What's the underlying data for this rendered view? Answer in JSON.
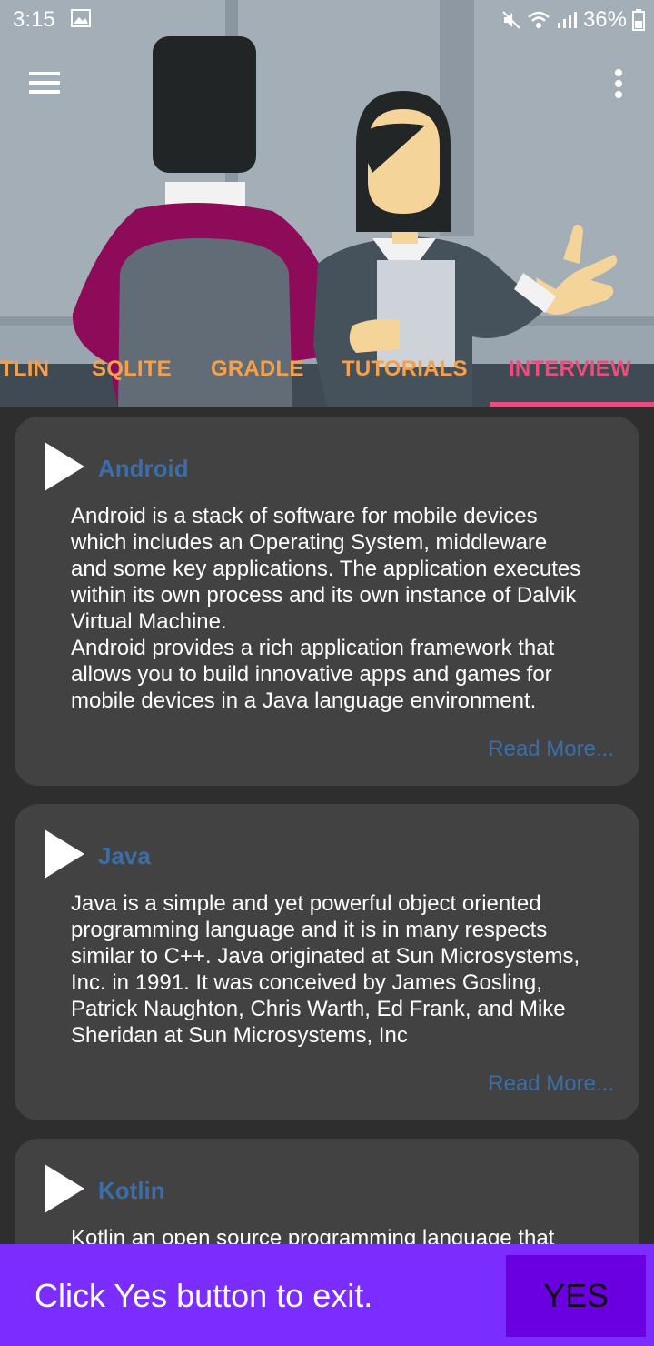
{
  "status": {
    "time": "3:15",
    "battery": "36%"
  },
  "icons": {
    "menu": "hamburger-menu-icon",
    "more": "more-vert-icon",
    "play": "play-triangle-icon"
  },
  "tabs": [
    {
      "label": "TLIN",
      "active": false
    },
    {
      "label": "SQLITE",
      "active": false
    },
    {
      "label": "GRADLE",
      "active": false
    },
    {
      "label": "TUTORIALS",
      "active": false
    },
    {
      "label": "INTERVIEW",
      "active": true
    }
  ],
  "cards": [
    {
      "title": "Android",
      "body": "Android is a stack of software for mobile devices\nwhich includes an Operating System, middleware\nand some key applications. The application executes\nwithin its own process and its own instance of Dalvik\nVirtual Machine.\nAndroid provides a rich application framework that\nallows you to build innovative apps and games for\nmobile devices in a Java language environment.",
      "more": "Read More..."
    },
    {
      "title": "Java",
      "body": "Java is a simple and yet powerful object oriented\nprogramming language and it is in many respects\nsimilar to C++. Java originated at Sun Microsystems,\nInc. in 1991. It was conceived by James Gosling,\nPatrick Naughton, Chris Warth, Ed Frank, and Mike\nSheridan at Sun Microsystems, Inc",
      "more": "Read More..."
    },
    {
      "title": "Kotlin",
      "body": "Kotlin an open source programming language that"
    }
  ],
  "exit_bar": {
    "message": "Click Yes button to exit.",
    "yes_label": "YES"
  },
  "colors": {
    "accent_tab": "#f7a04a",
    "active_tab": "#ef4c7a",
    "card_title": "#3a6ea8",
    "exit_bar": "#7b2cff"
  }
}
